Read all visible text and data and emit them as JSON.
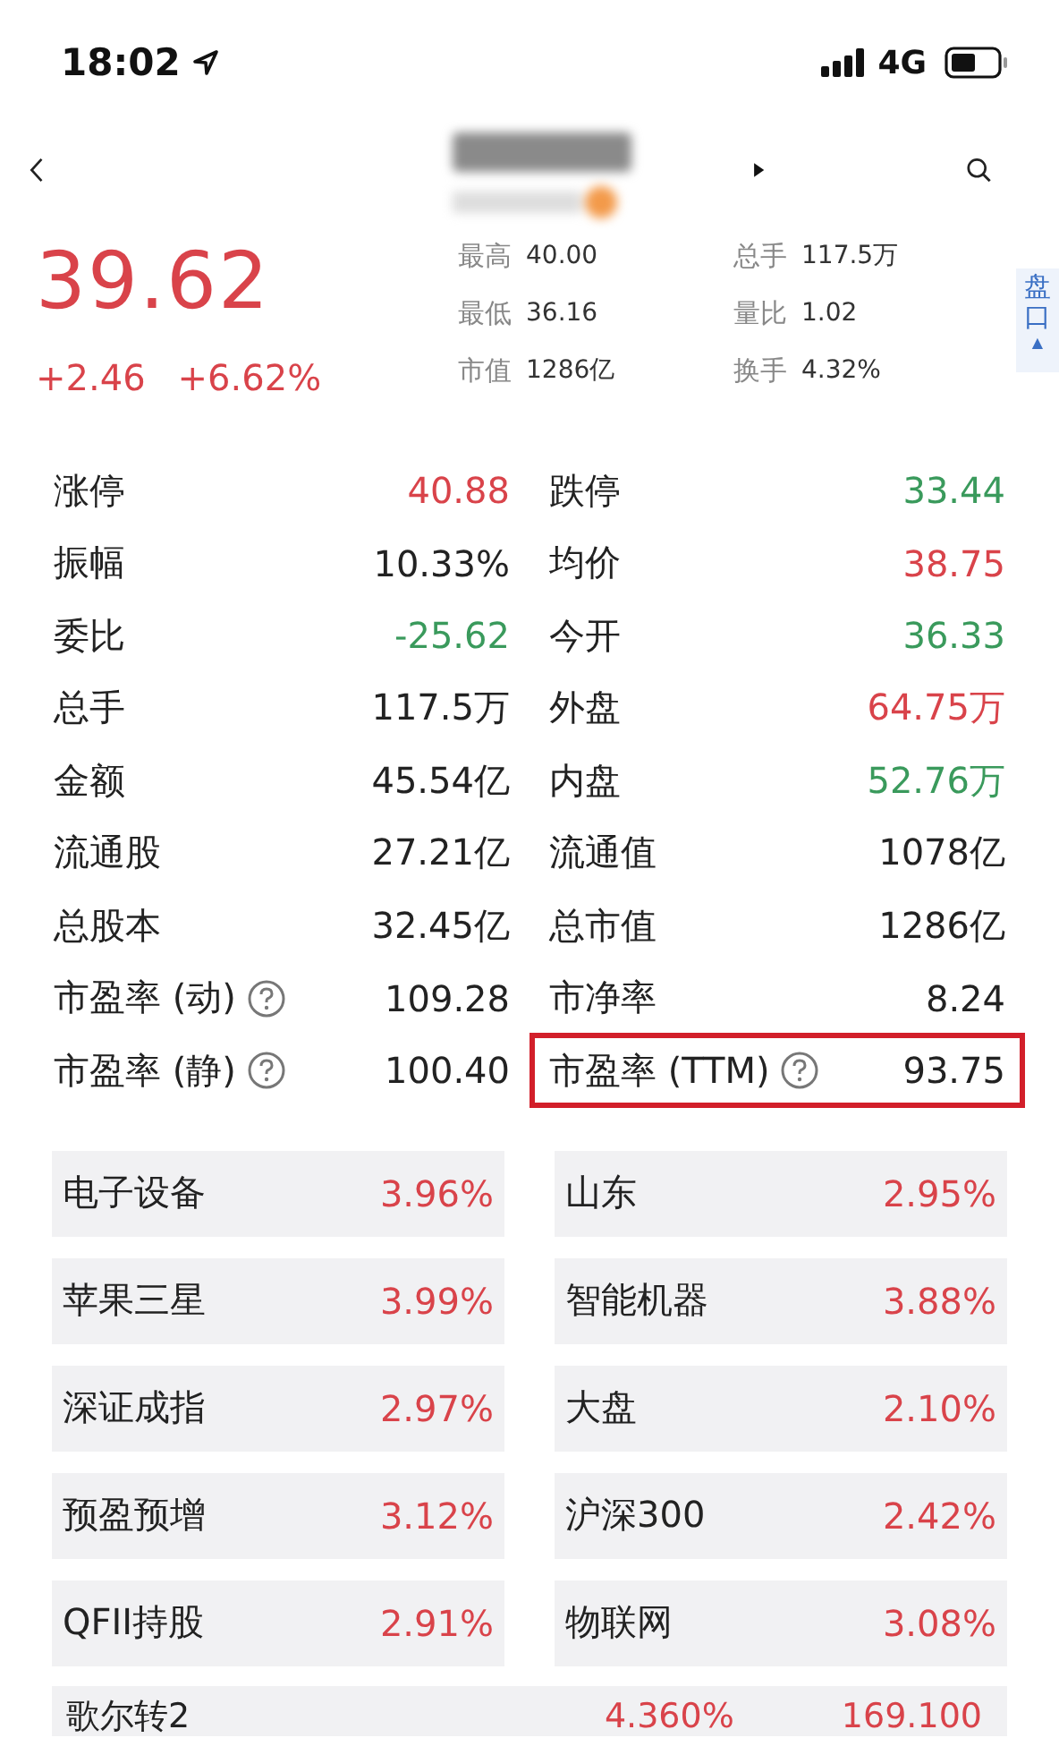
{
  "status_bar": {
    "time": "18:02",
    "network": "4G"
  },
  "quote": {
    "price": "39.62",
    "change": "+2.46",
    "change_pct": "+6.62%",
    "stats": [
      {
        "label": "最高",
        "value": "40.00"
      },
      {
        "label": "总手",
        "value": "117.5万"
      },
      {
        "label": "最低",
        "value": "36.16"
      },
      {
        "label": "量比",
        "value": "1.02"
      },
      {
        "label": "市值",
        "value": "1286亿"
      },
      {
        "label": "换手",
        "value": "4.32%"
      }
    ]
  },
  "side_tab": {
    "label": "盘口",
    "arrow": "▲"
  },
  "details": [
    {
      "label": "涨停",
      "value": "40.88",
      "color": "#d9434a",
      "help": false,
      "highlighted": false
    },
    {
      "label": "跌停",
      "value": "33.44",
      "color": "#3a9a5c",
      "help": false,
      "highlighted": false
    },
    {
      "label": "振幅",
      "value": "10.33%",
      "color": "#222222",
      "help": false,
      "highlighted": false
    },
    {
      "label": "均价",
      "value": "38.75",
      "color": "#d9434a",
      "help": false,
      "highlighted": false
    },
    {
      "label": "委比",
      "value": "-25.62",
      "color": "#3a9a5c",
      "help": false,
      "highlighted": false
    },
    {
      "label": "今开",
      "value": "36.33",
      "color": "#3a9a5c",
      "help": false,
      "highlighted": false
    },
    {
      "label": "总手",
      "value": "117.5万",
      "color": "#222222",
      "help": false,
      "highlighted": false
    },
    {
      "label": "外盘",
      "value": "64.75万",
      "color": "#d9434a",
      "help": false,
      "highlighted": false
    },
    {
      "label": "金额",
      "value": "45.54亿",
      "color": "#222222",
      "help": false,
      "highlighted": false
    },
    {
      "label": "内盘",
      "value": "52.76万",
      "color": "#3a9a5c",
      "help": false,
      "highlighted": false
    },
    {
      "label": "流通股",
      "value": "27.21亿",
      "color": "#222222",
      "help": false,
      "highlighted": false
    },
    {
      "label": "流通值",
      "value": "1078亿",
      "color": "#222222",
      "help": false,
      "highlighted": false
    },
    {
      "label": "总股本",
      "value": "32.45亿",
      "color": "#222222",
      "help": false,
      "highlighted": false
    },
    {
      "label": "总市值",
      "value": "1286亿",
      "color": "#222222",
      "help": false,
      "highlighted": false
    },
    {
      "label": "市盈率 (动)",
      "value": "109.28",
      "color": "#222222",
      "help": true,
      "highlighted": false
    },
    {
      "label": "市净率",
      "value": "8.24",
      "color": "#222222",
      "help": false,
      "highlighted": false
    },
    {
      "label": "市盈率 (静)",
      "value": "100.40",
      "color": "#222222",
      "help": true,
      "highlighted": false
    },
    {
      "label": "市盈率 (TTM)",
      "value": "93.75",
      "color": "#222222",
      "help": true,
      "highlighted": true
    }
  ],
  "sectors": [
    {
      "name": "电子设备",
      "change": "3.96%"
    },
    {
      "name": "山东",
      "change": "2.95%"
    },
    {
      "name": "苹果三星",
      "change": "3.99%"
    },
    {
      "name": "智能机器",
      "change": "3.88%"
    },
    {
      "name": "深证成指",
      "change": "2.97%"
    },
    {
      "name": "大盘",
      "change": "2.10%"
    },
    {
      "name": "预盈预增",
      "change": "3.12%"
    },
    {
      "name": "沪深300",
      "change": "2.42%"
    },
    {
      "name": "QFII持股",
      "change": "2.91%"
    },
    {
      "name": "物联网",
      "change": "3.08%"
    }
  ],
  "bond_row": {
    "name": "歌尔转2",
    "change": "4.360%",
    "price": "169.100"
  }
}
